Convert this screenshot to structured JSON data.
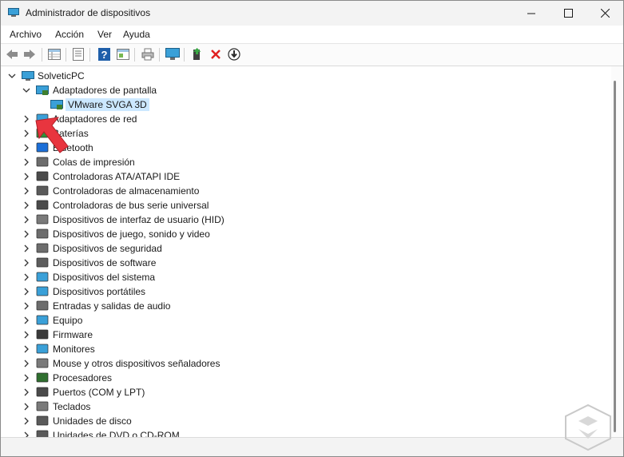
{
  "window": {
    "title": "Administrador de dispositivos",
    "controls": [
      "minimize",
      "maximize",
      "close"
    ]
  },
  "menu": [
    "Archivo",
    "Acción",
    "Ver",
    "Ayuda"
  ],
  "toolbar": [
    "back-icon",
    "forward-icon",
    "properties-grid-icon",
    "list-icon",
    "help-icon",
    "view-icon",
    "print-icon",
    "monitor-scan-icon",
    "enable-device-icon",
    "remove-device-icon",
    "download-driver-icon"
  ],
  "tree": {
    "root": "SolveticPC",
    "expanded_category": "Adaptadores de pantalla",
    "selected_device": "VMware SVGA 3D",
    "categories": [
      "Adaptadores de red",
      "Baterías",
      "Bluetooth",
      "Colas de impresión",
      "Controladoras ATA/ATAPI IDE",
      "Controladoras de almacenamiento",
      "Controladoras de bus serie universal",
      "Dispositivos de interfaz de usuario (HID)",
      "Dispositivos de juego, sonido y video",
      "Dispositivos de seguridad",
      "Dispositivos de software",
      "Dispositivos del sistema",
      "Dispositivos portátiles",
      "Entradas y salidas de audio",
      "Equipo",
      "Firmware",
      "Monitores",
      "Mouse y otros dispositivos señaladores",
      "Procesadores",
      "Puertos (COM y LPT)",
      "Teclados",
      "Unidades de disco",
      "Unidades de DVD o CD-ROM"
    ]
  },
  "colors": {
    "selection": "#cce8ff",
    "accent": "#0067c0",
    "arrow": "#e8353f"
  }
}
